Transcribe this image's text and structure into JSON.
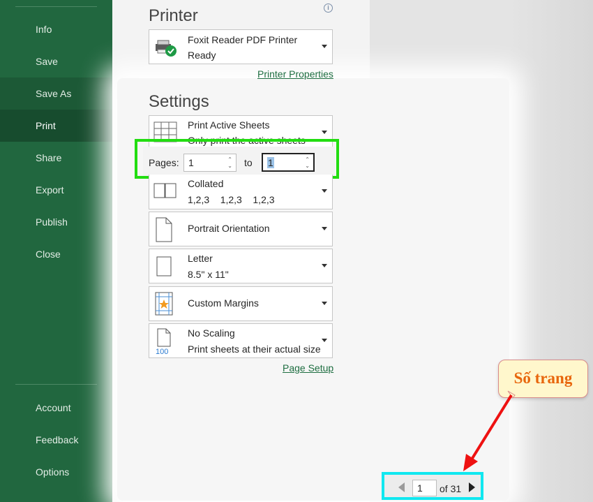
{
  "sidebar": {
    "items": [
      {
        "id": "info",
        "label": "Info"
      },
      {
        "id": "save",
        "label": "Save"
      },
      {
        "id": "save-as",
        "label": "Save As"
      },
      {
        "id": "print",
        "label": "Print"
      },
      {
        "id": "share",
        "label": "Share"
      },
      {
        "id": "export",
        "label": "Export"
      },
      {
        "id": "publish",
        "label": "Publish"
      },
      {
        "id": "close",
        "label": "Close"
      }
    ],
    "bottom_items": [
      {
        "id": "account",
        "label": "Account"
      },
      {
        "id": "feedback",
        "label": "Feedback"
      },
      {
        "id": "options",
        "label": "Options"
      }
    ]
  },
  "printer": {
    "title": "Printer",
    "name": "Foxit Reader PDF Printer",
    "status": "Ready",
    "properties_link": "Printer Properties"
  },
  "settings": {
    "title": "Settings",
    "print_what": {
      "line1": "Print Active Sheets",
      "line2": "Only print the active sheets"
    },
    "pages": {
      "label": "Pages:",
      "from": "1",
      "to_label": "to",
      "to": "1"
    },
    "collation": {
      "line1": "Collated",
      "line2": "1,2,3    1,2,3    1,2,3"
    },
    "orientation": {
      "line1": "Portrait Orientation"
    },
    "paper": {
      "line1": "Letter",
      "line2": "8.5\" x 11\""
    },
    "margins": {
      "line1": "Custom Margins"
    },
    "scaling": {
      "line1": "No Scaling",
      "line2": "Print sheets at their actual size",
      "icon_text": "100"
    },
    "page_setup_link": "Page Setup"
  },
  "page_nav": {
    "current": "1",
    "of_text": "of 31"
  },
  "callout": {
    "text": "Số trang"
  },
  "colors": {
    "sidebar_bg": "#21673f",
    "sidebar_active": "#174c2e",
    "highlight_green": "#22dd11",
    "highlight_cyan": "#10e8f0",
    "arrow_red": "#ee1111",
    "callout_text": "#e8660c",
    "link": "#1e6e41"
  }
}
